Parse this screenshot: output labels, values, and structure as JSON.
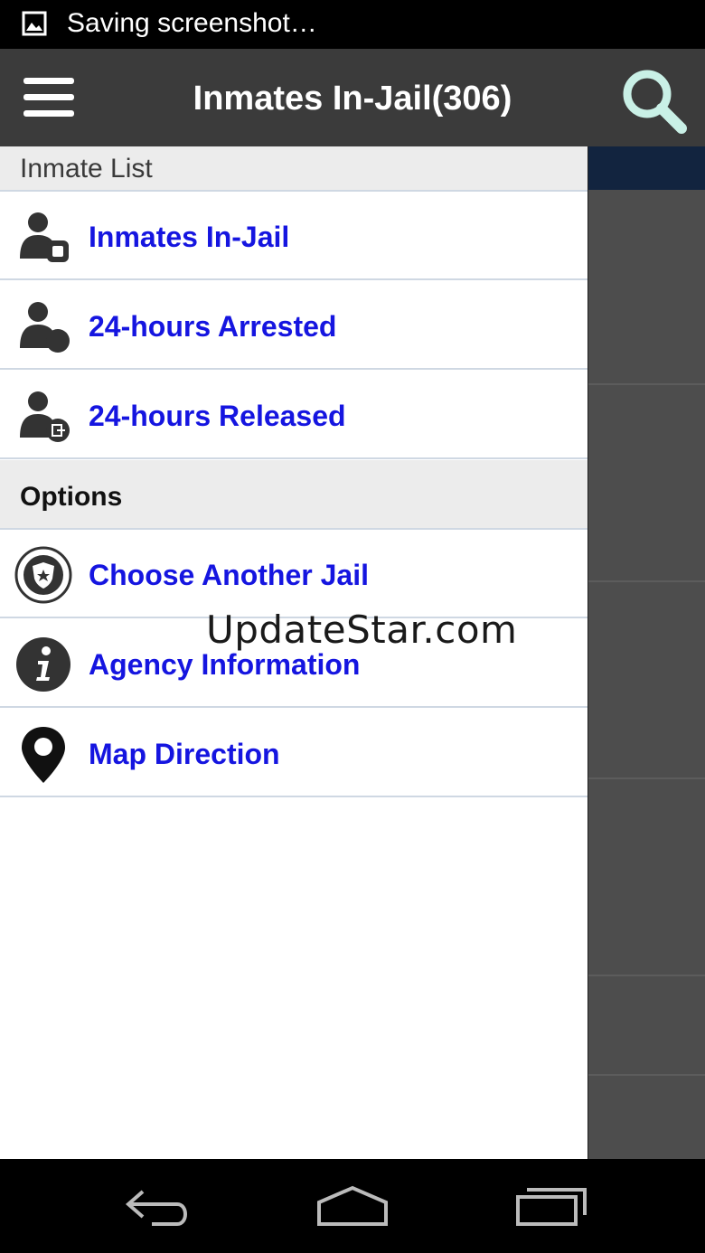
{
  "status_bar": {
    "text": "Saving screenshot…",
    "icon": "image-icon"
  },
  "action_bar": {
    "title": "Inmates In-Jail(306)",
    "menu_icon": "hamburger-menu-icon",
    "search_icon": "search-icon"
  },
  "drawer": {
    "sections": [
      {
        "label": "Inmate List",
        "items": [
          {
            "label": "Inmates In-Jail",
            "icon": "person-jail-icon"
          },
          {
            "label": "24-hours Arrested",
            "icon": "person-arrested-icon"
          },
          {
            "label": "24-hours Released",
            "icon": "person-released-icon"
          }
        ]
      },
      {
        "label": "Options",
        "items": [
          {
            "label": "Choose Another Jail",
            "icon": "police-badge-icon"
          },
          {
            "label": "Agency Information",
            "icon": "info-icon"
          },
          {
            "label": "Map Direction",
            "icon": "map-pin-icon"
          }
        ]
      }
    ]
  },
  "watermark": "UpdateStar.com",
  "nav_bar": {
    "back": "back-icon",
    "home": "home-icon",
    "recents": "recents-icon"
  },
  "colors": {
    "action_bar": "#3b3b3b",
    "link": "#1515e0",
    "section_bg": "#ececec",
    "accent_header": "#12243f"
  }
}
